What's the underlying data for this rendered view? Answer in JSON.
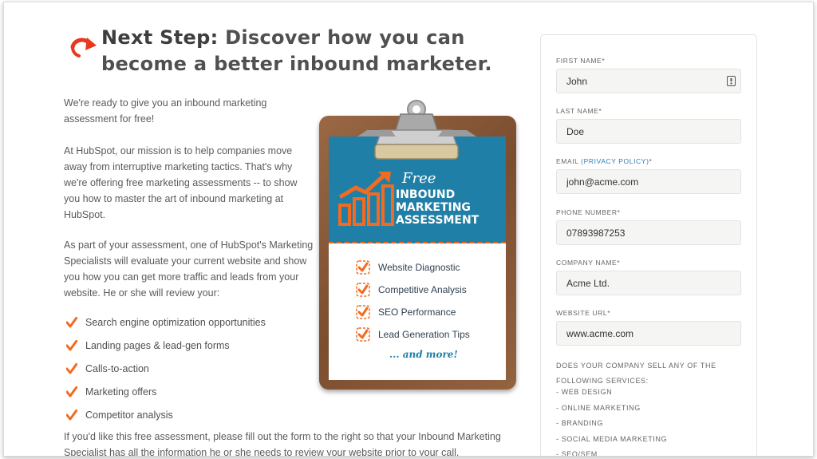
{
  "heading": {
    "lead": "Next Step:",
    "rest": " Discover how you can become a better inbound marketer."
  },
  "paragraphs": {
    "p1": "We're ready to give you an inbound marketing assessment for free!",
    "p2": "At HubSpot, our mission is to help companies move away from interruptive marketing tactics. That's why we're offering free marketing assessments -- to show you how to master the art of inbound marketing at HubSpot.",
    "p3": "As part of your assessment, one of HubSpot's Marketing Specialists will evaluate your current website and show you how you can get more traffic and leads from your website. He or she will review your:",
    "p4": "If you'd like this free assessment, please fill out the form to the right so that your Inbound Marketing Specialist has all the information he or she needs to review your website prior to your call."
  },
  "checklist": [
    "Search engine optimization opportunities",
    "Landing pages & lead-gen forms",
    "Calls-to-action",
    "Marketing offers",
    "Competitor analysis"
  ],
  "clipboard": {
    "free": "Free",
    "title": "INBOUND MARKETING ASSESSMENT",
    "items": [
      "Website Diagnostic",
      "Competitive Analysis",
      "SEO Performance",
      "Lead Generation Tips"
    ],
    "and_more": "... and more!"
  },
  "form": {
    "first_name": {
      "label": "FIRST NAME*",
      "value": "John"
    },
    "last_name": {
      "label": "LAST NAME*",
      "value": "Doe"
    },
    "email": {
      "label_pre": "EMAIL (",
      "label_link": "PRIVACY POLICY",
      "label_post": ")*",
      "value": "john@acme.com"
    },
    "phone": {
      "label": "PHONE NUMBER*",
      "value": "07893987253"
    },
    "company": {
      "label": "COMPANY NAME*",
      "value": "Acme Ltd."
    },
    "website": {
      "label": "WEBSITE URL*",
      "value": "www.acme.com"
    },
    "services_question": "DOES YOUR COMPANY SELL ANY OF THE FOLLOWING SERVICES:",
    "services": [
      "- WEB DESIGN",
      "- ONLINE MARKETING",
      "- BRANDING",
      "- SOCIAL MEDIA MARKETING",
      "- SEO/SEM"
    ]
  },
  "colors": {
    "accent_orange": "#f26b21",
    "clipboard_blue": "#1f7fa6",
    "link_blue": "#2b7fb8"
  },
  "icons": {
    "heading_arrow": "curved-arrow-icon",
    "check": "check-icon",
    "contact_card": "contact-card-icon"
  }
}
